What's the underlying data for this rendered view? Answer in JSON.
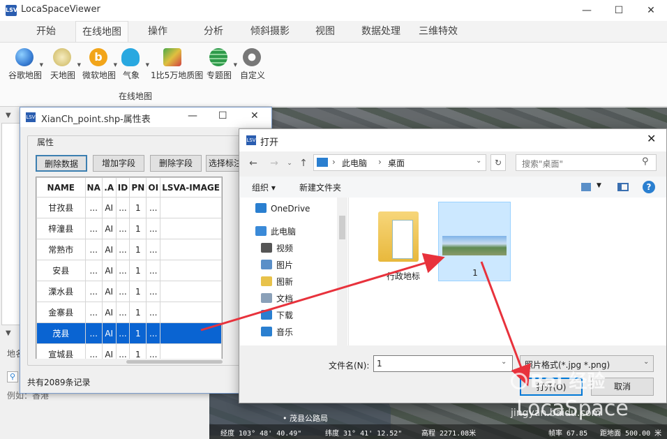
{
  "app": {
    "title": "LocaSpaceViewer",
    "icon": "LSV",
    "window_controls": [
      "—",
      "☐",
      "✕"
    ]
  },
  "ribbon": {
    "tabs": [
      {
        "label": "开始",
        "active": false
      },
      {
        "label": "在线地图",
        "active": true
      },
      {
        "label": "操作",
        "active": false
      },
      {
        "label": "分析",
        "active": false
      },
      {
        "label": "倾斜摄影",
        "active": false
      },
      {
        "label": "视图",
        "active": false
      },
      {
        "label": "数据处理",
        "active": false
      },
      {
        "label": "三维特效",
        "active": false
      }
    ],
    "buttons": [
      {
        "label": "谷歌地图",
        "icon": "google-earth-icon",
        "color": "#3a7fd5"
      },
      {
        "label": "天地图",
        "icon": "tianditu-icon",
        "color": "#d8c67a"
      },
      {
        "label": "微软地图",
        "icon": "bing-icon",
        "color": "#f2a51a"
      },
      {
        "label": "气象",
        "icon": "weather-cloud-icon",
        "color": "#29a8e0"
      },
      {
        "label": "1比5万地质图",
        "icon": "geology-map-icon",
        "color": "#4aa84a"
      },
      {
        "label": "专题图",
        "icon": "globe-grid-icon",
        "color": "#2e9a4a"
      },
      {
        "label": "自定义",
        "icon": "gear-icon",
        "color": "#777777"
      }
    ],
    "group_label": "在线地图"
  },
  "left_dock": {
    "location_placeholder": "地名",
    "example_text": "例如：香港"
  },
  "attr_window": {
    "title": "XianCh_point.shp-属性表",
    "group_label": "属性",
    "buttons": [
      "删除数据",
      "增加字段",
      "删除字段",
      "选择标注"
    ],
    "columns": [
      "NAME",
      "NA",
      ".A",
      "ID",
      "PN",
      "OI",
      "LSVA-IMAGE"
    ],
    "rows": [
      [
        "甘孜县",
        "...",
        "AI",
        "...",
        "1",
        "...",
        ""
      ],
      [
        "梓潼县",
        "...",
        "AI",
        "...",
        "1",
        "...",
        ""
      ],
      [
        "常熟市",
        "...",
        "AI",
        "...",
        "1",
        "...",
        ""
      ],
      [
        "安县",
        "...",
        "AI",
        "...",
        "1",
        "...",
        ""
      ],
      [
        "溧水县",
        "...",
        "AI",
        "...",
        "1",
        "...",
        ""
      ],
      [
        "金寨县",
        "...",
        "AI",
        "...",
        "1",
        "...",
        ""
      ],
      [
        "茂县",
        "...",
        "AI",
        "...",
        "1",
        "...",
        ""
      ],
      [
        "宣城县",
        "...",
        "AI",
        "...",
        "1",
        "...",
        ""
      ]
    ],
    "selected_row": 6,
    "record_count": "共有2089条记录"
  },
  "open_dialog": {
    "title": "打开",
    "address": [
      "此电脑",
      "桌面"
    ],
    "search_placeholder": "搜索\"桌面\"",
    "commands": [
      "组织 ▾",
      "新建文件夹"
    ],
    "nav_items": [
      {
        "label": "OneDrive",
        "icon": "onedrive-icon",
        "color": "#2a7fd0"
      },
      {
        "label": "此电脑",
        "icon": "computer-icon",
        "color": "#3a8ad8"
      },
      {
        "label": "视频",
        "icon": "video-icon",
        "color": "#555555"
      },
      {
        "label": "图片",
        "icon": "pictures-icon",
        "color": "#5a8fc8"
      },
      {
        "label": "图新",
        "icon": "folder-icon",
        "color": "#e8c24a"
      },
      {
        "label": "文档",
        "icon": "documents-icon",
        "color": "#8aa0b8"
      },
      {
        "label": "下载",
        "icon": "download-icon",
        "color": "#2a7fd0"
      },
      {
        "label": "音乐",
        "icon": "music-icon",
        "color": "#2a7fd0"
      }
    ],
    "files": [
      {
        "name": "行政地标",
        "type": "folder"
      },
      {
        "name": "1",
        "type": "image"
      }
    ],
    "filename_label": "文件名(N):",
    "filename_value": "1",
    "filetype": "照片格式(*.jpg *.png)",
    "open_label": "打开(O)",
    "cancel_label": "取消"
  },
  "status": {
    "map_label": "茂县公路局",
    "longitude": "经度 103° 48' 40.49\"",
    "latitude": "纬度 31° 41' 12.52\"",
    "elevation": "高程 2271.08米",
    "framerate": "帧率 67.85",
    "distance": "距地面 500.00 米"
  },
  "watermark": {
    "line1": "Bai 经验",
    "line2": "LocaSpace",
    "line3": "jingyan.baidu.com"
  },
  "colors": {
    "selection": "#0a64d2",
    "arrow": "#e8323c",
    "accent": "#2a5db0"
  }
}
